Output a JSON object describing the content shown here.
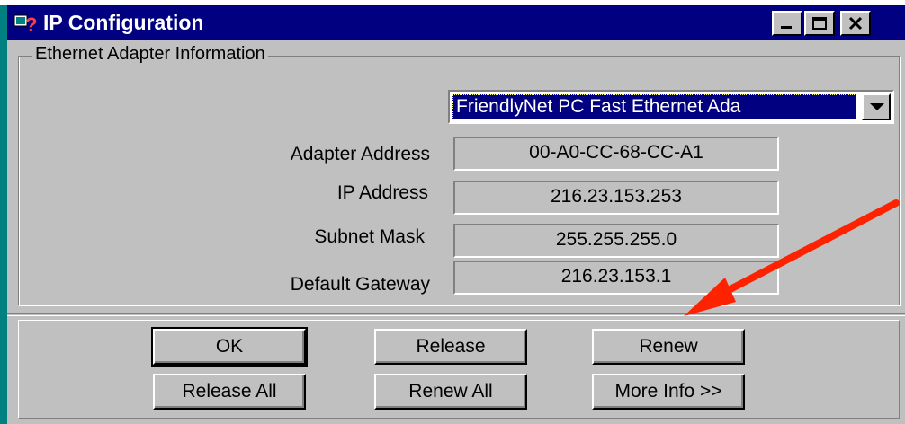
{
  "window": {
    "title": "IP Configuration",
    "icon": "ip-config-icon"
  },
  "title_buttons": {
    "minimize_icon": "minimize-icon",
    "maximize_icon": "maximize-icon",
    "close_icon": "close-icon",
    "close_glyph": "✕"
  },
  "adapter_info": {
    "group_label": "Ethernet  Adapter Information",
    "adapter_select": {
      "value": "FriendlyNet PC Fast Ethernet Ada",
      "dropdown_icon": "dropdown-arrow-icon"
    },
    "fields": [
      {
        "label": "Adapter Address",
        "value": "00-A0-CC-68-CC-A1"
      },
      {
        "label": "IP Address",
        "value": "216.23.153.253"
      },
      {
        "label": "Subnet Mask",
        "value": "255.255.255.0"
      },
      {
        "label": "Default Gateway",
        "value": "216.23.153.1"
      }
    ]
  },
  "buttons": {
    "ok": "OK",
    "release": "Release",
    "renew": "Renew",
    "release_all": "Release All",
    "renew_all": "Renew All",
    "more_info": "More Info >>"
  },
  "annotation": {
    "arrow_color": "#ff2200"
  },
  "colors": {
    "title_bar": "#000080",
    "face": "#c0c0c0",
    "selection": "#000080",
    "window_edge": "#008080"
  }
}
